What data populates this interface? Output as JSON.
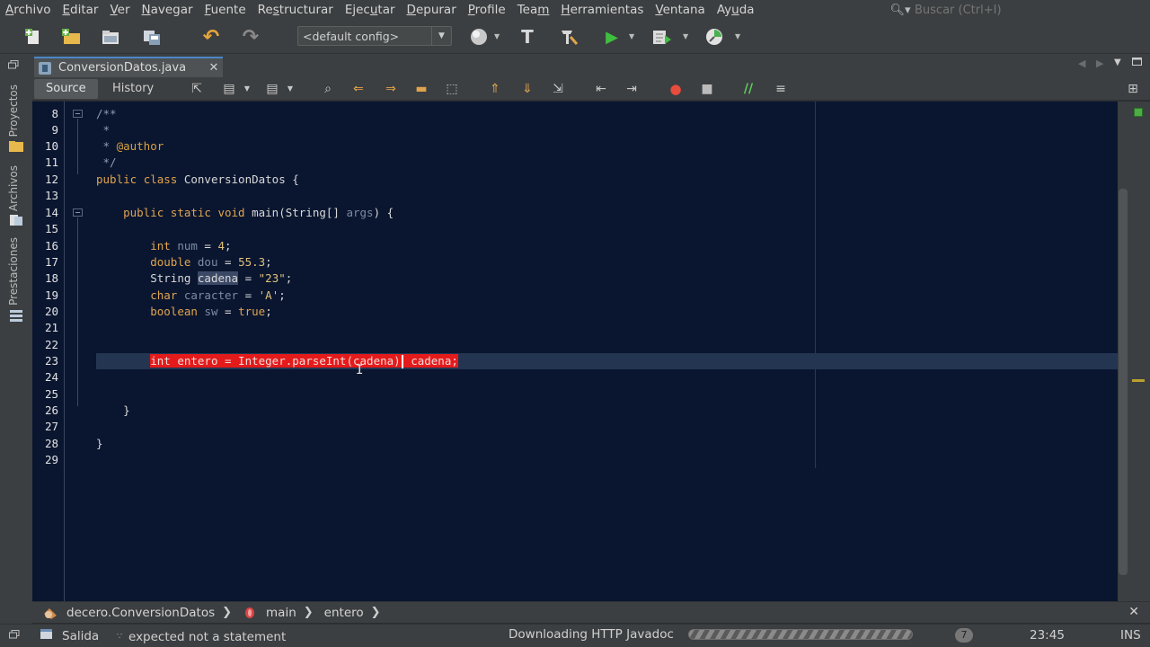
{
  "menu": [
    {
      "pre": "",
      "mn": "A",
      "post": "rchivo"
    },
    {
      "pre": "",
      "mn": "E",
      "post": "ditar"
    },
    {
      "pre": "",
      "mn": "V",
      "post": "er"
    },
    {
      "pre": "",
      "mn": "N",
      "post": "avegar"
    },
    {
      "pre": "",
      "mn": "F",
      "post": "uente"
    },
    {
      "pre": "Re",
      "mn": "s",
      "post": "tructurar"
    },
    {
      "pre": "Ejec",
      "mn": "u",
      "post": "tar"
    },
    {
      "pre": "",
      "mn": "D",
      "post": "epurar"
    },
    {
      "pre": "",
      "mn": "P",
      "post": "rofile"
    },
    {
      "pre": "Tea",
      "mn": "m",
      "post": ""
    },
    {
      "pre": "",
      "mn": "H",
      "post": "erramientas"
    },
    {
      "pre": "",
      "mn": "V",
      "post": "entana"
    },
    {
      "pre": "Ay",
      "mn": "u",
      "post": "da"
    }
  ],
  "search": {
    "placeholder": "Buscar (Ctrl+I)"
  },
  "toolbar": {
    "config": "<default config>"
  },
  "side_tabs": {
    "projects": "Proyectos",
    "files": "Archivos",
    "services": "Prestaciones"
  },
  "editor_tab": {
    "file_name": "ConversionDatos.java",
    "close": "✕"
  },
  "views": {
    "source": "Source",
    "history": "History"
  },
  "line_numbers": [
    "8",
    "9",
    "10",
    "11",
    "12",
    "13",
    "14",
    "15",
    "16",
    "17",
    "18",
    "19",
    "20",
    "21",
    "22",
    "23",
    "24",
    "25",
    "26",
    "27",
    "28",
    "29"
  ],
  "code": {
    "l8": "/**",
    "l9": " *",
    "l10_tag": "@author",
    "l11": " */",
    "l12_kw1": "public",
    "l12_kw2": "class",
    "l12_rest": " ConversionDatos {",
    "l14_kw": "public static void",
    "l14_rest1": " main(String[] ",
    "l14_var": "args",
    "l14_rest2": ") {",
    "l16_kw": "int",
    "l16_var": "num",
    "l16_val": "4",
    "l17_kw": "double",
    "l17_var": "dou",
    "l17_val": "55.3",
    "l18_type": "String",
    "l18_var": "cadena",
    "l18_val": "\"23\"",
    "l19_kw": "char",
    "l19_var": "caracter",
    "l19_val": "'A'",
    "l20_kw": "boolean",
    "l20_var": "sw",
    "l20_val": "true",
    "l23_part1": "int entero = Integer.parseInt(cadena)",
    "l23_part2": " cadena;",
    "l26": "}",
    "l28": "}"
  },
  "breadcrumb": [
    {
      "label": "decero.ConversionDatos",
      "icon": "class-icon"
    },
    {
      "label": "main",
      "icon": "method-icon"
    },
    {
      "label": "entero",
      "icon": ""
    }
  ],
  "status": {
    "output": "Salida",
    "message": "expected  not a statement",
    "task": "Downloading HTTP Javadoc",
    "notifications": "7",
    "position": "23:45",
    "mode": "INS"
  },
  "colors": {
    "editor_bg": "#0a1630",
    "keyword": "#e0a44e",
    "error_highlight": "#e51b1b",
    "current_line": "#243552"
  }
}
